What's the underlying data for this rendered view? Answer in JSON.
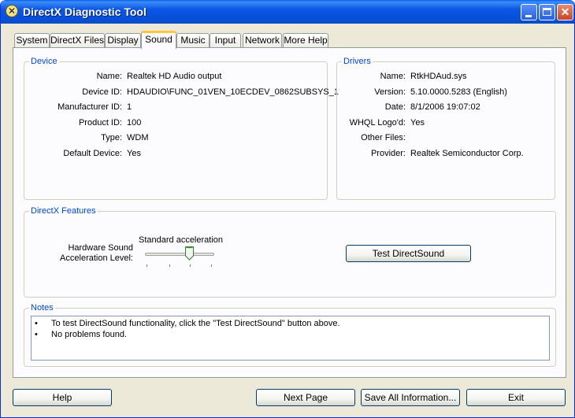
{
  "window": {
    "title": "DirectX Diagnostic Tool",
    "app_icon": "x-icon",
    "controls": {
      "minimize": "minimize-icon",
      "maximize": "maximize-icon",
      "close": "✕"
    }
  },
  "tabs": [
    {
      "label": "System",
      "active": false
    },
    {
      "label": "DirectX Files",
      "active": false
    },
    {
      "label": "Display",
      "active": false
    },
    {
      "label": "Sound",
      "active": true
    },
    {
      "label": "Music",
      "active": false
    },
    {
      "label": "Input",
      "active": false
    },
    {
      "label": "Network",
      "active": false
    },
    {
      "label": "More Help",
      "active": false
    }
  ],
  "device": {
    "title": "Device",
    "rows": [
      {
        "label": "Name:",
        "value": "Realtek HD Audio output"
      },
      {
        "label": "Device ID:",
        "value": "HDAUDIO\\FUNC_01VEN_10ECDEV_0862SUBSYS_1"
      },
      {
        "label": "Manufacturer ID:",
        "value": "1"
      },
      {
        "label": "Product ID:",
        "value": "100"
      },
      {
        "label": "Type:",
        "value": "WDM"
      },
      {
        "label": "Default Device:",
        "value": "Yes"
      }
    ]
  },
  "drivers": {
    "title": "Drivers",
    "rows": [
      {
        "label": "Name:",
        "value": "RtkHDAud.sys"
      },
      {
        "label": "Version:",
        "value": "5.10.0000.5283 (English)"
      },
      {
        "label": "Date:",
        "value": "8/1/2006 19:07:02"
      },
      {
        "label": "WHQL Logo'd:",
        "value": "Yes"
      },
      {
        "label": "Other Files:",
        "value": ""
      },
      {
        "label": "Provider:",
        "value": "Realtek Semiconductor Corp."
      }
    ]
  },
  "features": {
    "title": "DirectX Features",
    "accel_label_line1": "Hardware Sound",
    "accel_label_line2": "Acceleration Level:",
    "accel_value": "Standard acceleration",
    "slider_level_fraction": 0.67,
    "test_button": "Test DirectSound"
  },
  "notes": {
    "title": "Notes",
    "bullet": "•",
    "items": [
      "To test DirectSound functionality, click the \"Test DirectSound\" button above.",
      "No problems found."
    ]
  },
  "buttons": {
    "help": "Help",
    "next_page": "Next Page",
    "save_all": "Save All Information...",
    "exit": "Exit"
  },
  "colors": {
    "title_bar": "#0b56e4",
    "group_title": "#0046d5",
    "active_tab_accent": "#ffc73c",
    "dialog_bg": "#ece9d8"
  }
}
